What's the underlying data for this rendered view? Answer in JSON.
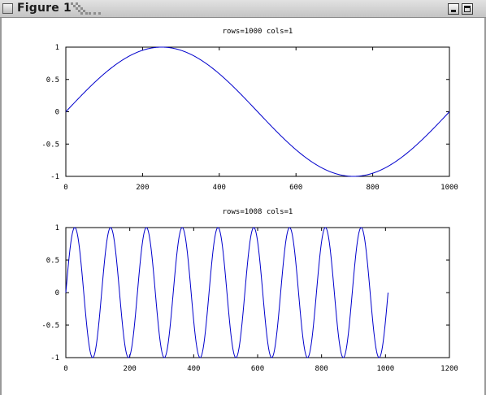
{
  "window": {
    "title": "Figure 1",
    "controls": [
      "minimize",
      "maximize"
    ]
  },
  "chart_data": [
    {
      "type": "line",
      "title": "rows=1000 cols=1",
      "xlabel": "",
      "ylabel": "",
      "xlim": [
        0,
        1000
      ],
      "ylim": [
        -1,
        1
      ],
      "xticks": [
        "0",
        "200",
        "400",
        "600",
        "800",
        "1000"
      ],
      "yticks": [
        "1",
        "0.5",
        "0",
        "-0.5",
        "-1"
      ],
      "series": [
        {
          "function": "y = sin(2*pi*x/1000)",
          "x_range": [
            0,
            1000
          ],
          "points": 1000,
          "color": "#0000cc"
        }
      ],
      "samples": {
        "x": [
          0,
          125,
          250,
          375,
          500,
          625,
          750,
          875,
          1000
        ],
        "y": [
          0,
          0.707,
          1,
          0.707,
          0,
          -0.707,
          -1,
          -0.707,
          0
        ]
      },
      "grid": false,
      "legend": "none"
    },
    {
      "type": "line",
      "title": "rows=1008 cols=1",
      "xlabel": "",
      "ylabel": "",
      "xlim": [
        0,
        1200
      ],
      "ylim": [
        -1,
        1
      ],
      "xticks": [
        "0",
        "200",
        "400",
        "600",
        "800",
        "1000",
        "1200"
      ],
      "yticks": [
        "1",
        "0.5",
        "0",
        "-0.5",
        "-1"
      ],
      "series": [
        {
          "function": "y = sin(2*pi*x/112)",
          "x_range": [
            0,
            1008
          ],
          "points": 1008,
          "cycles": 9,
          "color": "#0000cc"
        }
      ],
      "samples": {
        "x": [
          0,
          28,
          56,
          84,
          112,
          504,
          560,
          1008
        ],
        "y": [
          0,
          1,
          0,
          -1,
          0,
          0,
          0,
          0
        ]
      },
      "grid": false,
      "legend": "none"
    }
  ]
}
